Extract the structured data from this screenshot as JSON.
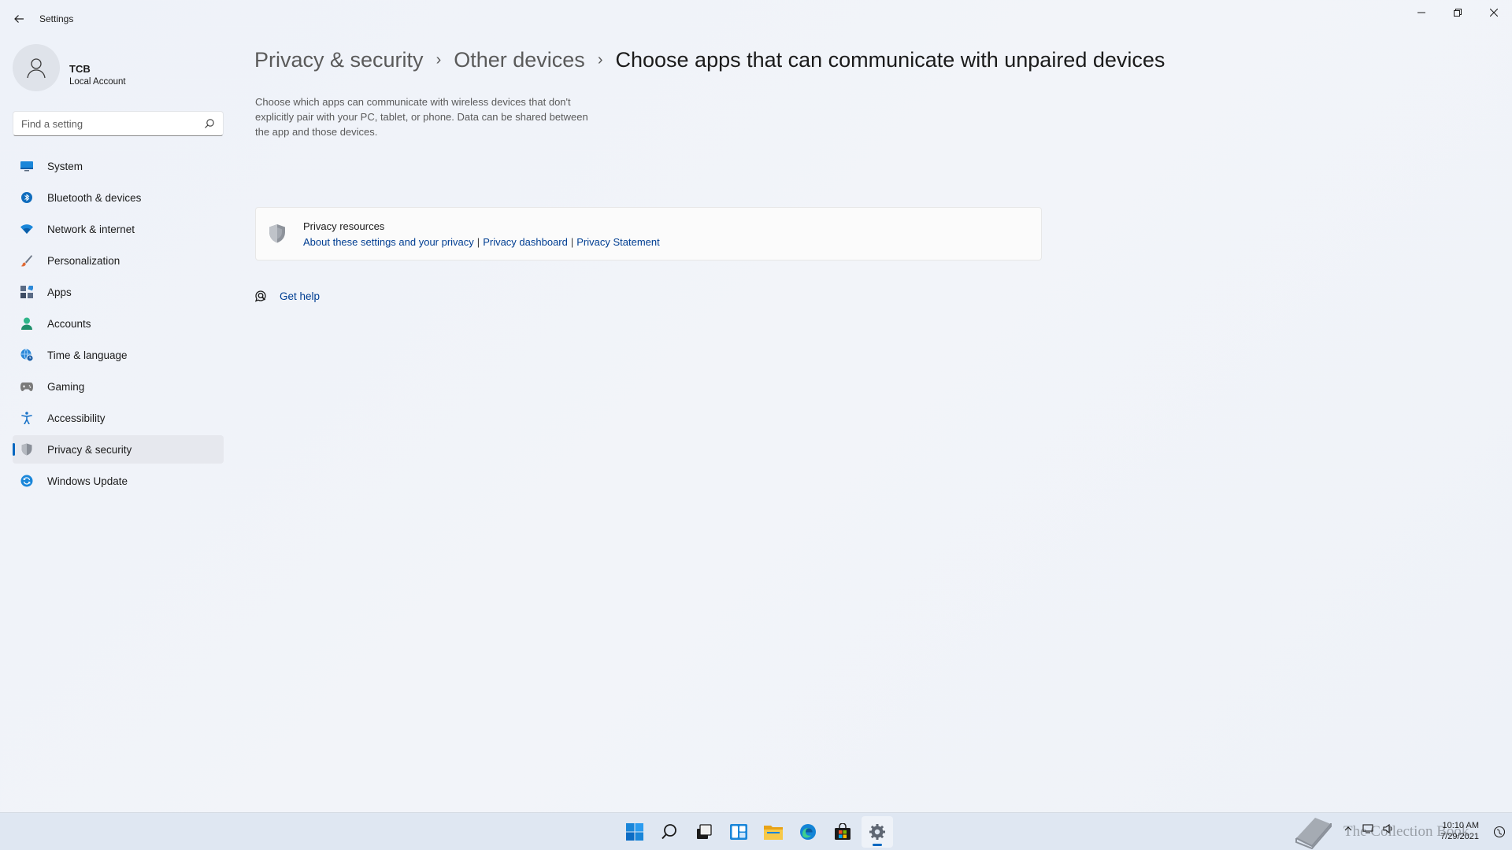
{
  "window": {
    "title": "Settings",
    "minimize_icon": "minimize-icon",
    "maximize_icon": "restore-icon",
    "close_icon": "close-icon"
  },
  "user": {
    "name": "TCB",
    "account_type": "Local Account"
  },
  "search": {
    "placeholder": "Find a setting",
    "value": ""
  },
  "sidebar": {
    "items": [
      {
        "label": "System",
        "icon": "system-icon",
        "color": "#0078d4"
      },
      {
        "label": "Bluetooth & devices",
        "icon": "bluetooth-icon",
        "color": "#0078d4"
      },
      {
        "label": "Network & internet",
        "icon": "wifi-icon",
        "color": "#0078d4"
      },
      {
        "label": "Personalization",
        "icon": "brush-icon",
        "color": "#c2502d"
      },
      {
        "label": "Apps",
        "icon": "apps-icon",
        "color": "#4a5a75"
      },
      {
        "label": "Accounts",
        "icon": "person-icon",
        "color": "#1fa37d"
      },
      {
        "label": "Time & language",
        "icon": "globe-clock-icon",
        "color": "#1a7bd4"
      },
      {
        "label": "Gaming",
        "icon": "gamepad-icon",
        "color": "#6b6b6b"
      },
      {
        "label": "Accessibility",
        "icon": "accessibility-icon",
        "color": "#1a73c8"
      },
      {
        "label": "Privacy & security",
        "icon": "shield-icon",
        "color": "#6b6b6b",
        "active": true
      },
      {
        "label": "Windows Update",
        "icon": "update-icon",
        "color": "#0078d4"
      }
    ]
  },
  "breadcrumb": {
    "items": [
      "Privacy & security",
      "Other devices",
      "Choose apps that can communicate with unpaired devices"
    ],
    "separator": "›"
  },
  "description": "Choose which apps can communicate with wireless devices that don't explicitly pair with your PC, tablet, or phone. Data can be shared between the app and those devices.",
  "privacy_resources": {
    "title": "Privacy resources",
    "links": [
      "About these settings and your privacy",
      "Privacy dashboard",
      "Privacy Statement"
    ],
    "separator": "|"
  },
  "help": {
    "label": "Get help"
  },
  "taskbar": {
    "apps": [
      "start-icon",
      "search-icon",
      "task-view-icon",
      "widgets-icon",
      "file-explorer-icon",
      "edge-icon",
      "store-icon",
      "settings-icon"
    ],
    "active_app": "settings-icon"
  },
  "tray": {
    "time": "10:10 AM",
    "date": "7/29/2021",
    "watermark": "The Collection Book"
  },
  "colors": {
    "accent": "#0067c0",
    "link": "#003e92"
  }
}
